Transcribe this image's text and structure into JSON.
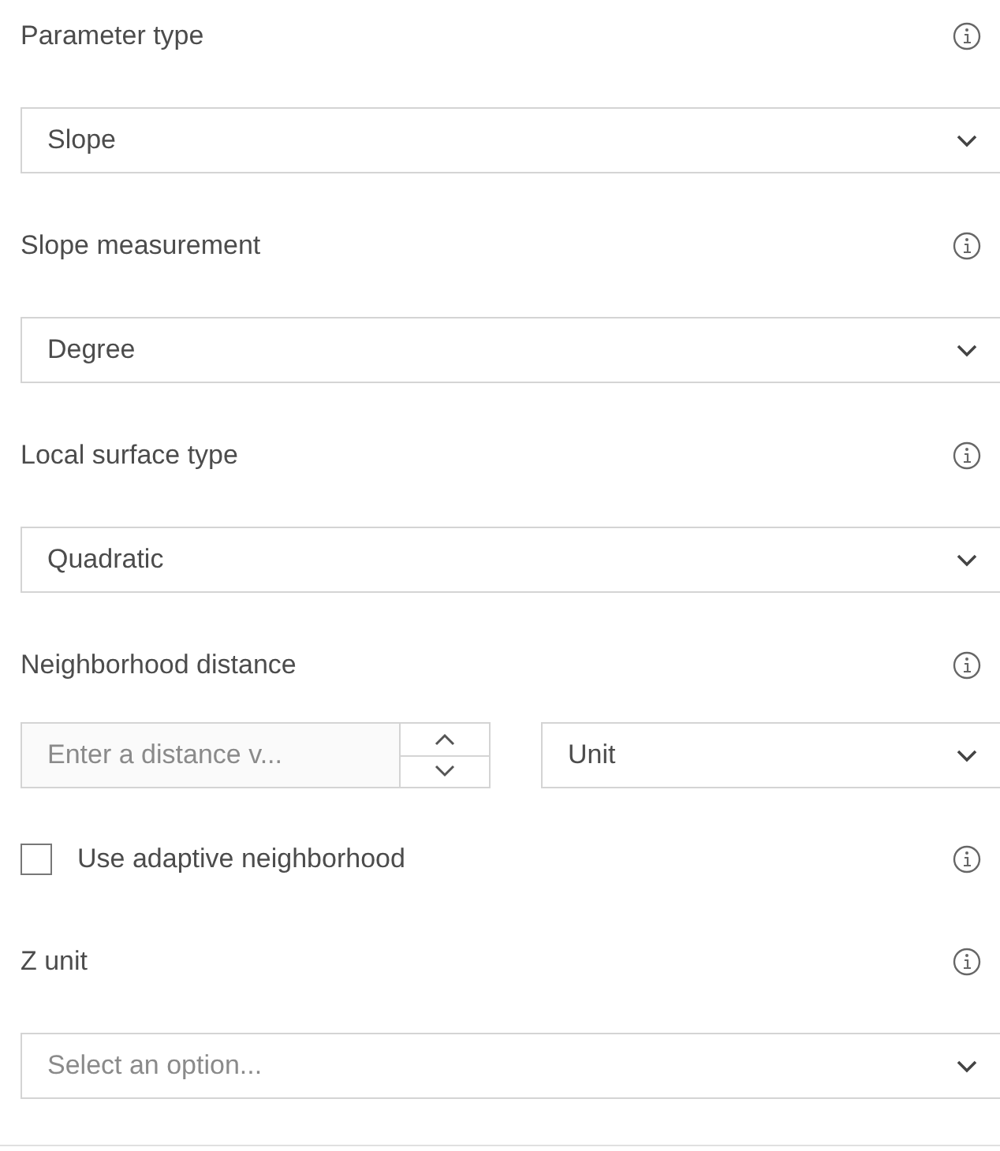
{
  "fields": [
    {
      "kind": "select",
      "label": "Parameter type",
      "value": "Slope"
    },
    {
      "kind": "select",
      "label": "Slope measurement",
      "value": "Degree"
    },
    {
      "kind": "select",
      "label": "Local surface type",
      "value": "Quadratic"
    },
    {
      "kind": "distance",
      "label": "Neighborhood distance",
      "placeholder": "Enter a distance v...",
      "unit": "Unit"
    },
    {
      "kind": "checkbox",
      "label": "Use adaptive neighborhood",
      "checked": false
    },
    {
      "kind": "select",
      "label": "Z unit",
      "placeholder": "Select an option..."
    }
  ]
}
